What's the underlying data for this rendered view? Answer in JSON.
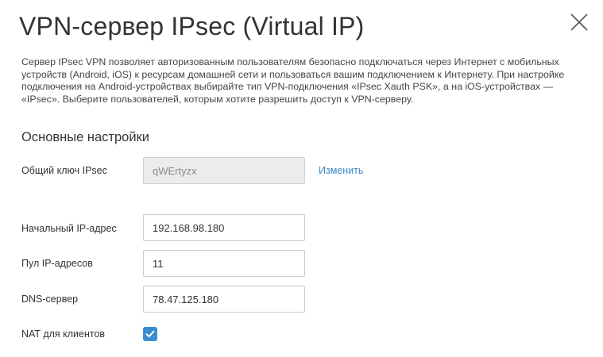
{
  "dialog": {
    "title": "VPN-сервер IPsec (Virtual IP)",
    "close_icon": "close-icon",
    "description": "Сервер IPsec VPN позволяет авторизованным пользователям безопасно подключаться через Интернет с мобильных устройств (Android, iOS) к ресурсам домашней сети и пользоваться вашим подключением к Интернету. При настройке подключения на Android-устройствах выбирайте тип VPN-подключения «IPsec Xauth PSK», а на iOS-устройствах — «IPsec». Выберите пользователей, которым хотите разрешить доступ к VPN-серверу."
  },
  "settings": {
    "section_title": "Основные настройки",
    "psk": {
      "label": "Общий ключ IPsec",
      "value": "qWErtyzx",
      "change_link": "Изменить"
    },
    "start_ip": {
      "label": "Начальный IP-адрес",
      "value": "192.168.98.180"
    },
    "pool": {
      "label": "Пул IP-адресов",
      "value": "11"
    },
    "dns": {
      "label": "DNS-сервер",
      "value": "78.47.125.180"
    },
    "nat": {
      "label": "NAT для клиентов",
      "checked": true,
      "icon": "checkmark-icon"
    }
  },
  "colors": {
    "link": "#3a89c4",
    "checkbox": "#3a8dd0",
    "text": "#333333",
    "disabled_field": "#ececec"
  }
}
